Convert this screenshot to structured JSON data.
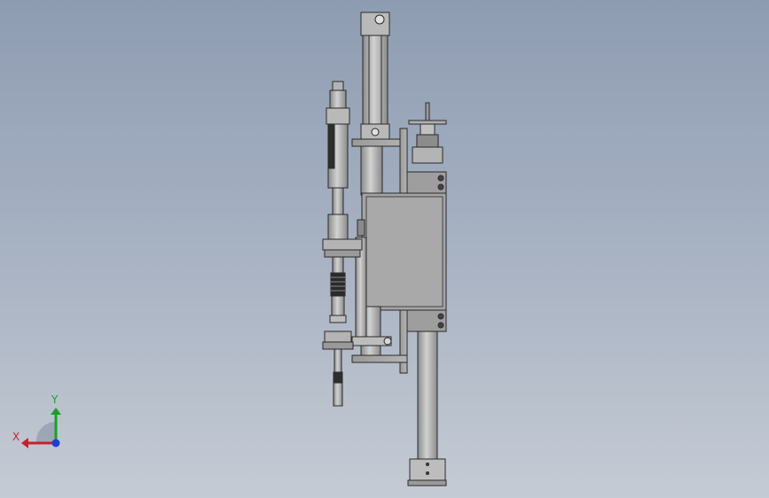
{
  "triad": {
    "x_label": "X",
    "y_label": "Y",
    "x_color": "#c8202a",
    "y_color": "#1f9d2a",
    "z_color": "#1f3fd0"
  },
  "colors": {
    "metal_light": "#c9c9c9",
    "metal_mid": "#a8a8a8",
    "metal_dark": "#7d7d7d",
    "outline": "#2a2a2a"
  }
}
